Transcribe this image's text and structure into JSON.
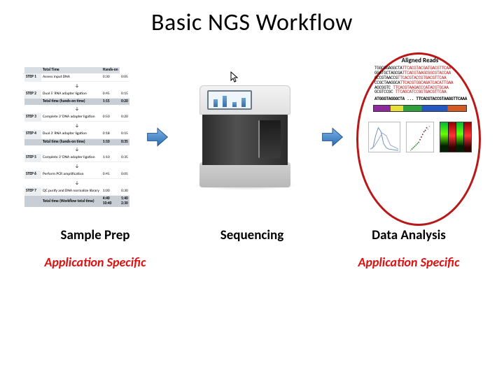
{
  "title": "Basic NGS Workflow",
  "columns": {
    "left": {
      "label": "Sample Prep",
      "tag": "Application Specific"
    },
    "mid": {
      "label": "Sequencing"
    },
    "right": {
      "label": "Data Analysis",
      "tag": "Application Specific"
    }
  },
  "sample_prep": {
    "header": [
      "",
      "Total Time",
      "Hands-on"
    ],
    "steps": [
      {
        "step": "STEP 1",
        "name": "Assess input DNA",
        "t": "0:30",
        "h": "0:05"
      },
      {
        "step": "STEP 2",
        "name": "Dual 5' RNA adapter ligation",
        "t": "0:45",
        "h": "0:15"
      }
    ],
    "subtotal1": {
      "label": "Total time",
      "note": "(hands-on time)",
      "t": "1:15",
      "h": "0:20"
    },
    "steps2": [
      {
        "step": "STEP 3",
        "name": "Complete 3' DNA adapter ligation",
        "t": "0:50",
        "h": "0:20"
      },
      {
        "step": "STEP 4",
        "name": "Dual 3' RNA adapter ligation",
        "t": "0:18",
        "h": "0:15"
      }
    ],
    "subtotal2": {
      "label": "Total time",
      "note": "(hands-on time)",
      "t": "1:10",
      "h": "0:35"
    },
    "day2": [
      {
        "step": "STEP 5",
        "name": "Complete 3' DNA adapter ligation",
        "t": "1:10",
        "h": "0:35"
      },
      {
        "step": "STEP 6",
        "name": "Perform PCR amplification",
        "t": "0:45",
        "h": "0:05"
      },
      {
        "step": "STEP 7",
        "name": "QC purify and DNA normalize library",
        "t": "1:00",
        "h": "0:30"
      }
    ],
    "grand": {
      "label": "Total time",
      "note": "(Workflow total time)",
      "t1": "4:40",
      "h1": "1:40",
      "t2": "10:40",
      "h2": "2:30"
    }
  },
  "data_analysis": {
    "aligned_title": "Aligned Reads",
    "reads": [
      {
        "pre": "TGGCGGAGGCTA",
        "hl": "TTCACGTACGATGACGTTCAA",
        "post": ""
      },
      {
        "pre": "GGATGCTAGCGA",
        "hl": "TTCACGTAAGCGGCGTACCAA",
        "post": ""
      },
      {
        "pre": " GCCGTAACCG",
        "hl": "TTCACGTACCGTGACGTTCAA",
        "post": ""
      },
      {
        "pre": "CCGCTAAGGCA",
        "hl": "TTCACGTGGCAGATCACATTGAA",
        "post": ""
      },
      {
        "pre": "AGCGGTC   ",
        "hl": "TTCACGTAAGACCCATACGTGCAA",
        "post": ""
      },
      {
        "pre": "GCGTCCGC  ",
        "hl": "TTCAGCATCCGGTGACGTTCAA",
        "post": ""
      }
    ],
    "reference": "ATGGGTAGGGCTA ... TTCACGTACCGTAAGGTTCAAA"
  },
  "icons": {
    "arrow": "flow-arrow",
    "cursor": "cursor-icon"
  }
}
